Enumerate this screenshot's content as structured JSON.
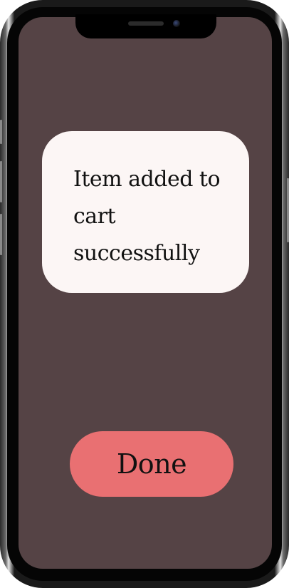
{
  "toast": {
    "message": "Item added to cart successfully"
  },
  "actions": {
    "done_label": "Done"
  },
  "colors": {
    "screen_background": "#554345",
    "toast_background": "#fcf6f5",
    "done_button": "#e97072",
    "text": "#111111"
  }
}
